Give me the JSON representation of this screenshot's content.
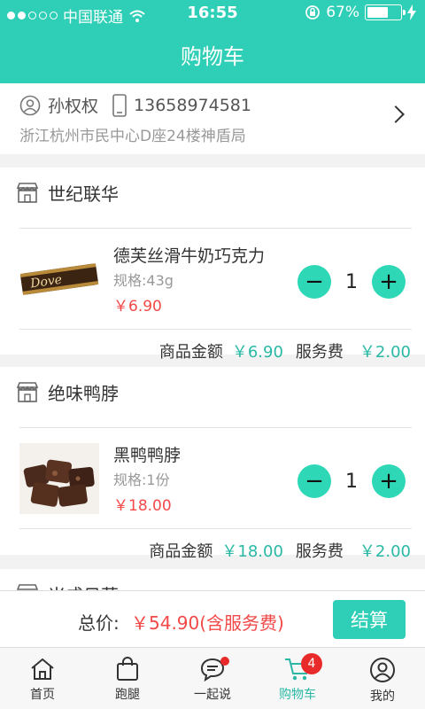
{
  "status_bar": {
    "carrier": "中国联通",
    "time": "16:55",
    "battery": "67%",
    "battery_level": 0.67
  },
  "header": {
    "title": "购物车"
  },
  "address": {
    "name": "孙权权",
    "phone": "13658974581",
    "address": "浙江杭州市民中心D座24楼神盾局"
  },
  "shops": [
    {
      "name": "世纪联华",
      "product": {
        "name": "德芙丝滑牛奶巧克力",
        "spec": "规格:43g",
        "price": "￥6.90",
        "qty": "1"
      },
      "goods_label": "商品金额",
      "goods_amount": "￥6.90",
      "service_label": "服务费",
      "service_fee": "￥2.00"
    },
    {
      "name": "绝味鸭脖",
      "product": {
        "name": "黑鸭鸭脖",
        "spec": "规格:1份",
        "price": "￥18.00",
        "qty": "1"
      },
      "goods_label": "商品金额",
      "goods_amount": "￥18.00",
      "service_label": "服务费",
      "service_fee": "￥2.00"
    },
    {
      "name": "米成日草"
    }
  ],
  "checkout": {
    "total_label": "总价:",
    "total_amount": "￥54.90(含服务费)",
    "pay_button": "结算"
  },
  "tabbar": {
    "items": [
      {
        "label": "首页",
        "icon": "home-icon"
      },
      {
        "label": "跑腿",
        "icon": "bag-icon"
      },
      {
        "label": "一起说",
        "icon": "chat-icon"
      },
      {
        "label": "购物车",
        "icon": "cart-icon",
        "badge": "4",
        "active": true
      },
      {
        "label": "我的",
        "icon": "user-icon"
      }
    ]
  },
  "colors": {
    "accent": "#2fcfb7",
    "price_red": "#f24848",
    "amount_teal": "#2ab8a5"
  }
}
